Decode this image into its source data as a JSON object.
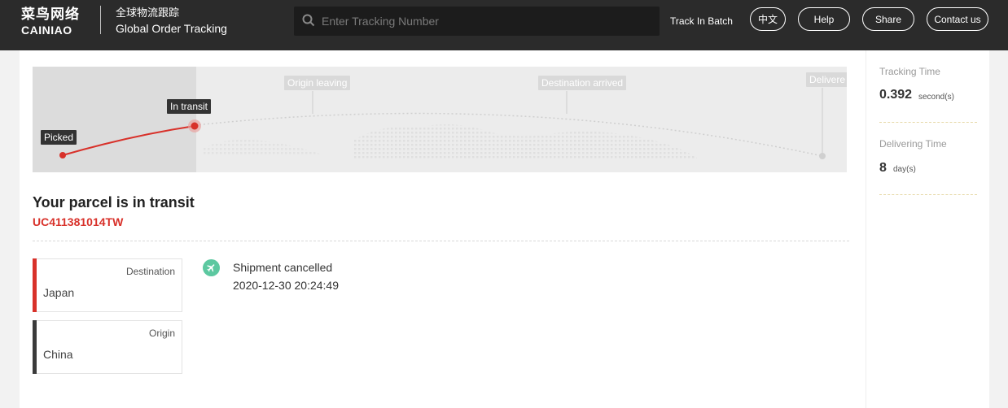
{
  "header": {
    "logo_cn": "菜鸟网络",
    "logo_en": "CAINIAO",
    "title_cn": "全球物流跟踪",
    "title_en": "Global Order Tracking",
    "search_placeholder": "Enter Tracking Number",
    "track_batch": "Track In Batch",
    "lang_button": "中文",
    "help_button": "Help",
    "share_button": "Share",
    "contact_button": "Contact us"
  },
  "map": {
    "stages": {
      "picked": "Picked",
      "in_transit": "In transit",
      "origin_leaving": "Origin leaving",
      "destination_arrived": "Destination arrived",
      "delivered": "Delivere"
    },
    "progress_color": "#d8312a"
  },
  "parcel": {
    "status_title": "Your parcel is in transit",
    "tracking_number": "UC411381014TW",
    "destination_label": "Destination",
    "destination_value": "Japan",
    "origin_label": "Origin",
    "origin_value": "China"
  },
  "events": [
    {
      "icon": "airplane-icon",
      "description": "Shipment cancelled",
      "time": "2020-12-30 20:24:49"
    }
  ],
  "sidebar": {
    "tracking_time_label": "Tracking Time",
    "tracking_time_value": "0.392",
    "tracking_time_unit": "second(s)",
    "delivering_time_label": "Delivering Time",
    "delivering_time_value": "8",
    "delivering_time_unit": "day(s)"
  },
  "colors": {
    "header_bg": "#2b2b2b",
    "accent_red": "#d8312a",
    "event_green": "#5cc8a0"
  }
}
